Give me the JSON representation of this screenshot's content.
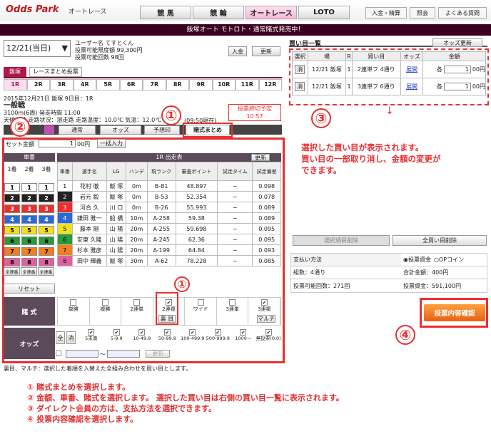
{
  "header": {
    "logo": "Odds Park",
    "sub": "オートレース",
    "tabs": [
      "競 馬",
      "競 輪",
      "オートレース",
      "LOTO"
    ],
    "util": [
      "入金・精算",
      "照会",
      "よくある質問"
    ]
  },
  "banner": "飯塚オート モトロト・通常賭式発売中！",
  "date_select": "12/21(当日)",
  "user": {
    "name": "ユーザー名 てすとくん",
    "limit": "投票可能限度額 99,300円",
    "count": "投票可能回数 98回",
    "deposit": "入金",
    "refresh": "更新"
  },
  "venue_tabs": [
    "飯塚",
    "レースまとめ投票"
  ],
  "races": [
    "1R",
    "2R",
    "3R",
    "4R",
    "5R",
    "6R",
    "7R",
    "8R",
    "9R",
    "10R",
    "11R",
    "12R"
  ],
  "race_info": {
    "line1": "2015年12月21日 飯塚 9日目：1R",
    "line2": "一般戦",
    "line3": "3100m(6周) 発走時間 11:00",
    "line4": "天候：晴 走路状況：湿走路 走路温度：10.0℃ 気温：12.0℃ 湿",
    "line5": "(09:50現在)",
    "deadline": "投票締切予定",
    "deadline_time": "10:57"
  },
  "bet_tabs": [
    "通常",
    "オッズ",
    "予想印",
    "賭式まとめ"
  ],
  "set_amount": {
    "label": "セット金額",
    "value": "1",
    "unit": "00円",
    "bulk": "一括入力"
  },
  "left_hdr": {
    "title": "車番",
    "cols": [
      "1着",
      "2着",
      "3着"
    ]
  },
  "race_table": {
    "title": "1R 出走表",
    "refresh": "更新",
    "headers": [
      "車番",
      "選手名",
      "LG",
      "ハンデ",
      "現ランク",
      "審査ポイント",
      "試走タイム",
      "試走偏差"
    ],
    "rows": [
      [
        "1",
        "花村 徹",
        "飯 塚",
        "0m",
        "B-81",
        "48.897",
        "−",
        "0.098"
      ],
      [
        "2",
        "岩元 毅",
        "飯 塚",
        "0m",
        "B-53",
        "52.354",
        "−",
        "0.078"
      ],
      [
        "3",
        "河合 久",
        "川 口",
        "0m",
        "B-26",
        "55.993",
        "−",
        "0.089"
      ],
      [
        "4",
        "鎌田 雅一",
        "船 橋",
        "10m",
        "A-258",
        "59.38",
        "−",
        "0.089"
      ],
      [
        "5",
        "藤本 剛",
        "山 陽",
        "20m",
        "A-255",
        "59.698",
        "−",
        "0.095"
      ],
      [
        "6",
        "安東 久隆",
        "山 陽",
        "20m",
        "A-245",
        "62.36",
        "−",
        "0.095"
      ],
      [
        "7",
        "杉本 雅彦",
        "山 陽",
        "20m",
        "A-199",
        "64.84",
        "−",
        "0.093"
      ],
      [
        "8",
        "田中 輝義",
        "飯 塚",
        "30m",
        "A-62",
        "78.228",
        "−",
        "0.085"
      ]
    ]
  },
  "row_colors": [
    "#ffffff",
    "#222222",
    "#e83030",
    "#2a6ad8",
    "#f0e020",
    "#2a9a3a",
    "#f08020",
    "#e060a0"
  ],
  "all_labels": [
    "全連番",
    "全連番",
    "全連番"
  ],
  "reset": "リセット",
  "bet_types": {
    "label": "賭 式",
    "items": [
      "単勝",
      "複勝",
      "2連単",
      "2連複",
      "ワイド",
      "3連単",
      "3連複"
    ],
    "ura": "裏 目",
    "multi": "マルチ"
  },
  "odds": {
    "label": "オッズ",
    "all": "全",
    "clear": "消",
    "ranges": [
      "5未満",
      "5-9.9",
      "10-49.9",
      "50-99.9",
      "100-499.9",
      "500-999.9",
      "1000〜",
      "無投票(0.0)"
    ],
    "refresh": "更新"
  },
  "foot_note": "裏目、マルチ：選択した着順を入替えた全組み合わせを買い目とします。",
  "buy_list": {
    "title": "買い目一覧",
    "odds_refresh": "オッズ更新",
    "headers": [
      "選択",
      "場",
      "R",
      "買い目",
      "オッズ",
      "金額"
    ],
    "rows": [
      {
        "del": "消",
        "venue": "12/21 飯塚",
        "r": "1",
        "bet": "2連単フ 4通り",
        "odds": "展開",
        "prefix": "各",
        "amount": "1",
        "unit": "00円"
      },
      {
        "del": "消",
        "venue": "12/21 飯塚",
        "r": "1",
        "bet": "3連単フ 6通り",
        "odds": "展開",
        "prefix": "各",
        "amount": "1",
        "unit": "00円"
      }
    ]
  },
  "note3": [
    "選択した買い目が表示されます。",
    "買い目の一部取り消し、金額の変更が",
    "できます。"
  ],
  "actions": {
    "del_sel": "選択項目削除",
    "del_all": "全買い目削除"
  },
  "payment": {
    "label": "支払い方法",
    "opt1": "投票資金",
    "opt2": "OPコイン",
    "count": "組数：4通り",
    "total": "合計金額：400円",
    "possible": "投票可能回数：271回",
    "fund": "投票資金：591,100円"
  },
  "confirm": "投票内容確認",
  "steps": [
    "① 賭式まとめを選択します。",
    "② 金額、車番、賭式を選択します。 選択した買い目は右側の買い目一覧に表示されます。",
    "③ ダイレクト会員の方は、支払方法を選択できます。",
    "④ 投票内容確認を選択します。"
  ],
  "circles": [
    "①",
    "②",
    "③",
    "④",
    "①"
  ]
}
